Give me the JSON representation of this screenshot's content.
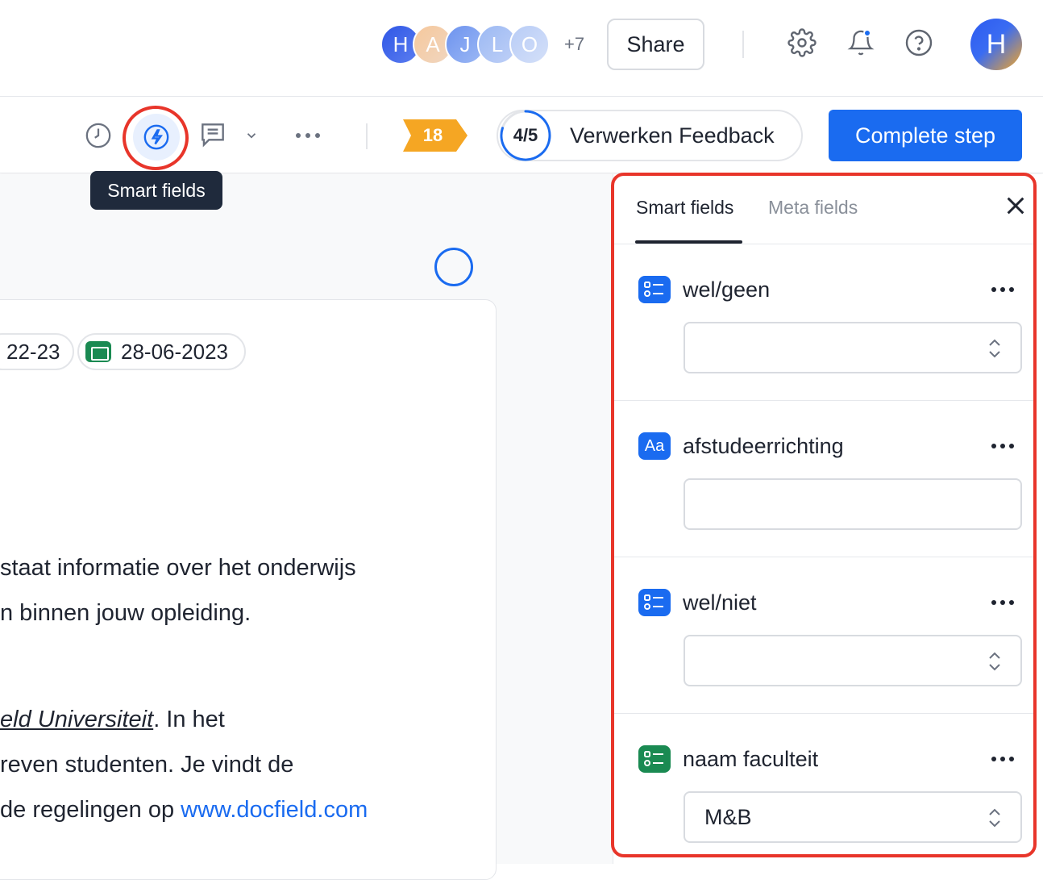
{
  "topbar": {
    "avatars": [
      {
        "initial": "H",
        "color": "#3b5de7"
      },
      {
        "initial": "A",
        "color": "#f3c9a3"
      },
      {
        "initial": "J",
        "color": "#7aa0f0"
      },
      {
        "initial": "L",
        "color": "#a9c4f5"
      },
      {
        "initial": "O",
        "color": "#c7d6f8"
      }
    ],
    "more_count": "+7",
    "share_label": "Share",
    "icons": [
      "gear-icon",
      "bell-icon",
      "help-icon"
    ],
    "user_initial": "H"
  },
  "toolbar": {
    "icons": [
      "clock-icon",
      "lightning-icon",
      "comment-icon",
      "chevron-down-icon",
      "more-icon"
    ],
    "badge_count": "18",
    "step_fraction": "4/5",
    "step_progress": 0.8,
    "step_name": "Verwerken Feedback",
    "complete_label": "Complete step",
    "tooltip": "Smart fields"
  },
  "document": {
    "chip_period": "22-23",
    "chip_date": "28-06-2023",
    "lines": [
      "staat informatie over het onderwijs",
      "n binnen jouw opleiding.",
      "eld Universiteit",
      ". In het",
      "reven studenten. Je vindt de",
      "de regelingen op ",
      "www.docfield.com"
    ]
  },
  "panel": {
    "tabs": [
      "Smart fields",
      "Meta fields"
    ],
    "fields": [
      {
        "label": "wel/geen",
        "type": "select",
        "value": "",
        "icon_text": "",
        "icon_color": "#1a6bf0"
      },
      {
        "label": "afstudeerrichting",
        "type": "text",
        "value": "",
        "icon_text": "Aa",
        "icon_color": "#1a6bf0"
      },
      {
        "label": "wel/niet",
        "type": "select",
        "value": "",
        "icon_text": "",
        "icon_color": "#1a6bf0"
      },
      {
        "label": "naam faculteit",
        "type": "select",
        "value": "M&B",
        "icon_text": "",
        "icon_color": "#1a8a52"
      }
    ]
  },
  "colors": {
    "accent": "#1a6bf0",
    "highlight": "#e8352a",
    "badge": "#f5a623",
    "success": "#1a8a52"
  }
}
